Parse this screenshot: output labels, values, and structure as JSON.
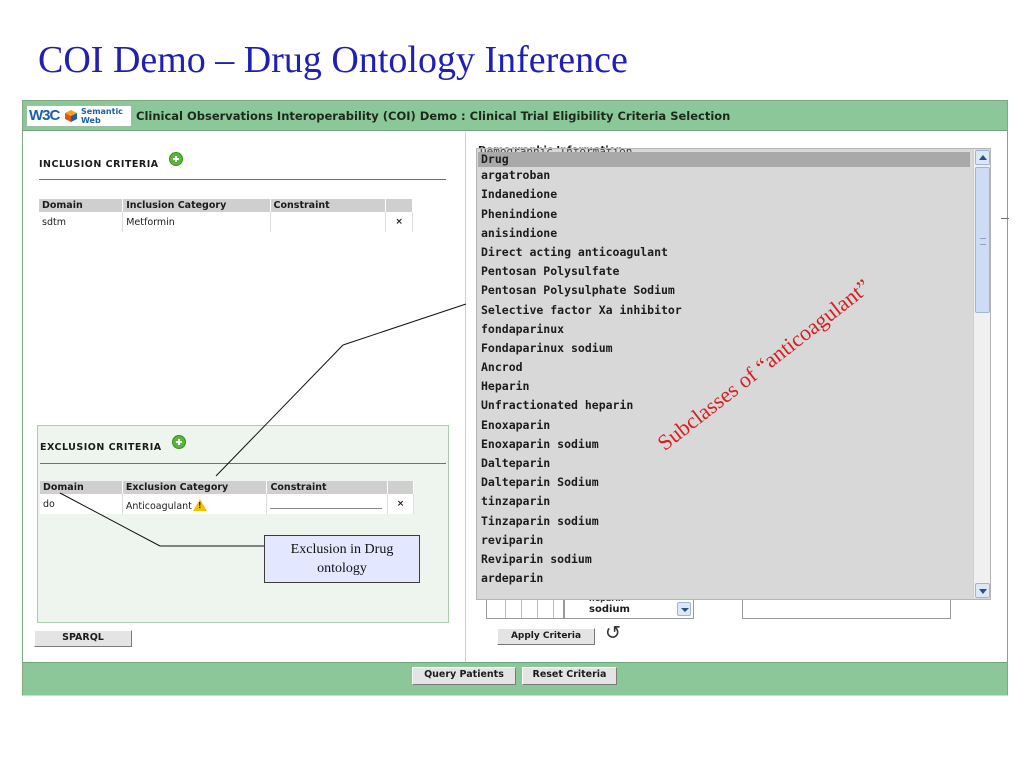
{
  "slide": {
    "title": "COI Demo – Drug Ontology Inference"
  },
  "app": {
    "logo": {
      "mark": "W3C",
      "line1": "Semantic",
      "line2": "Web"
    },
    "title": "Clinical Observations Interoperability (COI) Demo : Clinical Trial Eligibility Criteria Selection"
  },
  "inclusion": {
    "label": "INCLUSION CRITERIA",
    "columns": [
      "Domain",
      "Inclusion Category",
      "Constraint"
    ],
    "rows": [
      {
        "domain": "sdtm",
        "category": "Metformin",
        "constraint": "",
        "delete": "×"
      }
    ]
  },
  "exclusion": {
    "label": "EXCLUSION CRITERIA",
    "columns": [
      "Domain",
      "Exclusion Category",
      "Constraint"
    ],
    "rows": [
      {
        "domain": "do",
        "category": "Anticoagulant",
        "constraint": "",
        "delete": "×"
      }
    ]
  },
  "buttons": {
    "sparql": "SPARQL",
    "apply": "Apply Criteria",
    "query": "Query Patients",
    "reset": "Reset Criteria"
  },
  "right": {
    "section_label": "Demographic Information",
    "select_value": "sodium",
    "select_peek": "heparin",
    "refresh_glyph": "↺"
  },
  "drug_list": {
    "items": [
      "Drug",
      "argatroban",
      "Indanedione",
      "Phenindione",
      "anisindione",
      "Direct acting anticoagulant",
      "Pentosan Polysulfate",
      "Pentosan Polysulphate Sodium",
      "Selective factor Xa inhibitor",
      "fondaparinux",
      "Fondaparinux sodium",
      "Ancrod",
      "Heparin",
      "Unfractionated heparin",
      "Enoxaparin",
      "Enoxaparin sodium",
      "Dalteparin",
      "Dalteparin Sodium",
      "tinzaparin",
      "Tinzaparin sodium",
      "reviparin",
      "Reviparin sodium",
      "ardeparin"
    ]
  },
  "annotations": {
    "callout_line1": "Exclusion in Drug",
    "callout_line2": "ontology",
    "subclasses_label": "Subclasses of “anticoagulant”"
  },
  "colors": {
    "title": "#1f1fb4",
    "header": "#8cc79a",
    "annotation": "#d62020"
  }
}
